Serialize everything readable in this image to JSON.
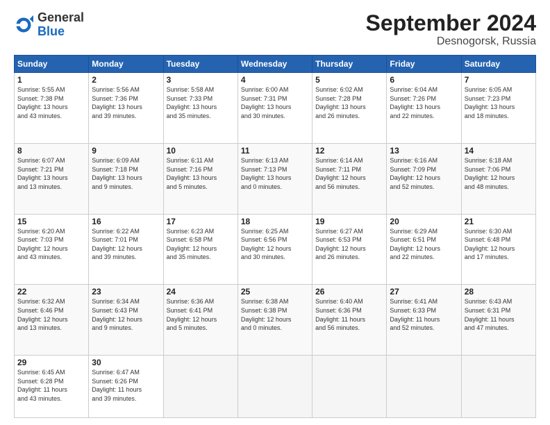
{
  "header": {
    "logo_general": "General",
    "logo_blue": "Blue",
    "month_title": "September 2024",
    "subtitle": "Desnogorsk, Russia"
  },
  "calendar": {
    "days_of_week": [
      "Sunday",
      "Monday",
      "Tuesday",
      "Wednesday",
      "Thursday",
      "Friday",
      "Saturday"
    ],
    "weeks": [
      [
        {
          "day": "1",
          "info": "Sunrise: 5:55 AM\nSunset: 7:38 PM\nDaylight: 13 hours\nand 43 minutes."
        },
        {
          "day": "2",
          "info": "Sunrise: 5:56 AM\nSunset: 7:36 PM\nDaylight: 13 hours\nand 39 minutes."
        },
        {
          "day": "3",
          "info": "Sunrise: 5:58 AM\nSunset: 7:33 PM\nDaylight: 13 hours\nand 35 minutes."
        },
        {
          "day": "4",
          "info": "Sunrise: 6:00 AM\nSunset: 7:31 PM\nDaylight: 13 hours\nand 30 minutes."
        },
        {
          "day": "5",
          "info": "Sunrise: 6:02 AM\nSunset: 7:28 PM\nDaylight: 13 hours\nand 26 minutes."
        },
        {
          "day": "6",
          "info": "Sunrise: 6:04 AM\nSunset: 7:26 PM\nDaylight: 13 hours\nand 22 minutes."
        },
        {
          "day": "7",
          "info": "Sunrise: 6:05 AM\nSunset: 7:23 PM\nDaylight: 13 hours\nand 18 minutes."
        }
      ],
      [
        {
          "day": "8",
          "info": "Sunrise: 6:07 AM\nSunset: 7:21 PM\nDaylight: 13 hours\nand 13 minutes."
        },
        {
          "day": "9",
          "info": "Sunrise: 6:09 AM\nSunset: 7:18 PM\nDaylight: 13 hours\nand 9 minutes."
        },
        {
          "day": "10",
          "info": "Sunrise: 6:11 AM\nSunset: 7:16 PM\nDaylight: 13 hours\nand 5 minutes."
        },
        {
          "day": "11",
          "info": "Sunrise: 6:13 AM\nSunset: 7:13 PM\nDaylight: 13 hours\nand 0 minutes."
        },
        {
          "day": "12",
          "info": "Sunrise: 6:14 AM\nSunset: 7:11 PM\nDaylight: 12 hours\nand 56 minutes."
        },
        {
          "day": "13",
          "info": "Sunrise: 6:16 AM\nSunset: 7:09 PM\nDaylight: 12 hours\nand 52 minutes."
        },
        {
          "day": "14",
          "info": "Sunrise: 6:18 AM\nSunset: 7:06 PM\nDaylight: 12 hours\nand 48 minutes."
        }
      ],
      [
        {
          "day": "15",
          "info": "Sunrise: 6:20 AM\nSunset: 7:03 PM\nDaylight: 12 hours\nand 43 minutes."
        },
        {
          "day": "16",
          "info": "Sunrise: 6:22 AM\nSunset: 7:01 PM\nDaylight: 12 hours\nand 39 minutes."
        },
        {
          "day": "17",
          "info": "Sunrise: 6:23 AM\nSunset: 6:58 PM\nDaylight: 12 hours\nand 35 minutes."
        },
        {
          "day": "18",
          "info": "Sunrise: 6:25 AM\nSunset: 6:56 PM\nDaylight: 12 hours\nand 30 minutes."
        },
        {
          "day": "19",
          "info": "Sunrise: 6:27 AM\nSunset: 6:53 PM\nDaylight: 12 hours\nand 26 minutes."
        },
        {
          "day": "20",
          "info": "Sunrise: 6:29 AM\nSunset: 6:51 PM\nDaylight: 12 hours\nand 22 minutes."
        },
        {
          "day": "21",
          "info": "Sunrise: 6:30 AM\nSunset: 6:48 PM\nDaylight: 12 hours\nand 17 minutes."
        }
      ],
      [
        {
          "day": "22",
          "info": "Sunrise: 6:32 AM\nSunset: 6:46 PM\nDaylight: 12 hours\nand 13 minutes."
        },
        {
          "day": "23",
          "info": "Sunrise: 6:34 AM\nSunset: 6:43 PM\nDaylight: 12 hours\nand 9 minutes."
        },
        {
          "day": "24",
          "info": "Sunrise: 6:36 AM\nSunset: 6:41 PM\nDaylight: 12 hours\nand 5 minutes."
        },
        {
          "day": "25",
          "info": "Sunrise: 6:38 AM\nSunset: 6:38 PM\nDaylight: 12 hours\nand 0 minutes."
        },
        {
          "day": "26",
          "info": "Sunrise: 6:40 AM\nSunset: 6:36 PM\nDaylight: 11 hours\nand 56 minutes."
        },
        {
          "day": "27",
          "info": "Sunrise: 6:41 AM\nSunset: 6:33 PM\nDaylight: 11 hours\nand 52 minutes."
        },
        {
          "day": "28",
          "info": "Sunrise: 6:43 AM\nSunset: 6:31 PM\nDaylight: 11 hours\nand 47 minutes."
        }
      ],
      [
        {
          "day": "29",
          "info": "Sunrise: 6:45 AM\nSunset: 6:28 PM\nDaylight: 11 hours\nand 43 minutes."
        },
        {
          "day": "30",
          "info": "Sunrise: 6:47 AM\nSunset: 6:26 PM\nDaylight: 11 hours\nand 39 minutes."
        },
        {
          "day": "",
          "info": ""
        },
        {
          "day": "",
          "info": ""
        },
        {
          "day": "",
          "info": ""
        },
        {
          "day": "",
          "info": ""
        },
        {
          "day": "",
          "info": ""
        }
      ]
    ]
  }
}
